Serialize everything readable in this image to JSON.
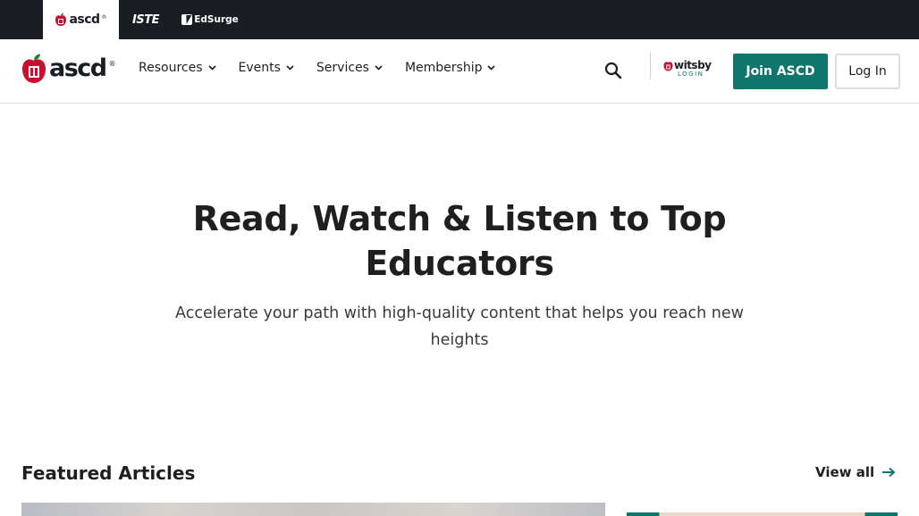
{
  "brand_bar": {
    "brands": [
      {
        "name": "ascd",
        "reg": "®"
      },
      {
        "name": "ISTE"
      },
      {
        "name": "EdSurge"
      }
    ]
  },
  "header": {
    "logo": {
      "word": "ascd",
      "reg": "®"
    },
    "nav": [
      {
        "label": "Resources"
      },
      {
        "label": "Events"
      },
      {
        "label": "Services"
      },
      {
        "label": "Membership"
      }
    ],
    "witsby": {
      "word": "witsby",
      "sub": "LOGIN"
    },
    "join_label": "Join ASCD",
    "login_label": "Log In"
  },
  "hero": {
    "title": "Read, Watch & Listen to Top Educators",
    "subtitle": "Accelerate your path with high-quality content that helps you reach new heights"
  },
  "featured": {
    "title": "Featured Articles",
    "view_all": "View all"
  },
  "colors": {
    "brand_bar": "#1a1d24",
    "accent_teal": "#0f766e",
    "logo_red": "#c8102e",
    "logo_green": "#2e7d32"
  }
}
